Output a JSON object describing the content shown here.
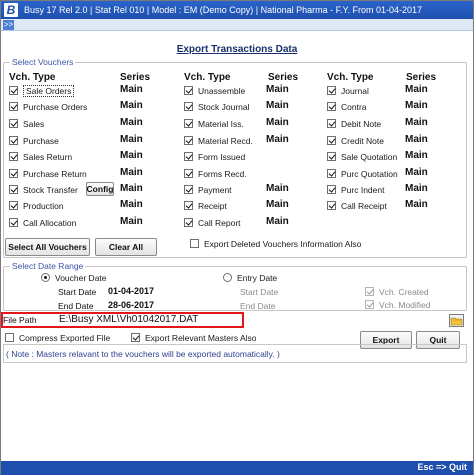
{
  "window": {
    "title": "Busy 17  Rel 2.0  |  Stat Rel 010  |  Model : EM (Demo Copy)  |  National Pharma - F.Y. From 01-04-2017",
    "logo_letter": "B",
    "expand_label": ">>"
  },
  "panel_title": "Export Transactions Data",
  "vouchers": {
    "legend": "Select Vouchers",
    "headers": {
      "vch_type": "Vch. Type",
      "series": "Series"
    },
    "columns": [
      [
        {
          "label": "Sale Orders",
          "series": "Main",
          "checked": true
        },
        {
          "label": "Purchase Orders",
          "series": "Main",
          "checked": true
        },
        {
          "label": "Sales",
          "series": "Main",
          "checked": true
        },
        {
          "label": "Purchase",
          "series": "Main",
          "checked": true
        },
        {
          "label": "Sales Return",
          "series": "Main",
          "checked": true
        },
        {
          "label": "Purchase Return",
          "series": "Main",
          "checked": true
        },
        {
          "label": "Stock Transfer",
          "series": "Main",
          "checked": true
        },
        {
          "label": "Production",
          "series": "Main",
          "checked": true
        },
        {
          "label": "Call Allocation",
          "series": "Main",
          "checked": true
        }
      ],
      [
        {
          "label": "Unassemble",
          "series": "Main",
          "checked": true
        },
        {
          "label": "Stock Journal",
          "series": "Main",
          "checked": true
        },
        {
          "label": "Material Iss.",
          "series": "Main",
          "checked": true
        },
        {
          "label": "Material Recd.",
          "series": "Main",
          "checked": true
        },
        {
          "label": "Form Issued",
          "series": "",
          "checked": true
        },
        {
          "label": "Forms Recd.",
          "series": "",
          "checked": true
        },
        {
          "label": "Payment",
          "series": "Main",
          "checked": true
        },
        {
          "label": "Receipt",
          "series": "Main",
          "checked": true
        },
        {
          "label": "Call Report",
          "series": "Main",
          "checked": true
        }
      ],
      [
        {
          "label": "Journal",
          "series": "Main",
          "checked": true
        },
        {
          "label": "Contra",
          "series": "Main",
          "checked": true
        },
        {
          "label": "Debit Note",
          "series": "Main",
          "checked": true
        },
        {
          "label": "Credit Note",
          "series": "Main",
          "checked": true
        },
        {
          "label": "Sale Quotation",
          "series": "Main",
          "checked": true
        },
        {
          "label": "Purc Quotation",
          "series": "Main",
          "checked": true
        },
        {
          "label": "Purc Indent",
          "series": "Main",
          "checked": true
        },
        {
          "label": "Call Receipt",
          "series": "Main",
          "checked": true
        }
      ]
    ],
    "config_label": "Config",
    "select_all_label": "Select All Vouchers",
    "clear_all_label": "Clear All",
    "export_deleted_label": "Export Deleted Vouchers Information Also"
  },
  "date_range": {
    "legend": "Select Date Range",
    "voucher_date_label": "Voucher Date",
    "entry_date_label": "Entry Date",
    "start_date_label": "Start Date",
    "end_date_label": "End Date",
    "voucher_start": "01-04-2017",
    "voucher_end": "28-06-2017",
    "vch_created_label": "Vch. Created",
    "vch_modified_label": "Vch. Modified"
  },
  "file_path": {
    "label": "File Path",
    "value": "E:\\Busy XML\\Vh01042017.DAT"
  },
  "options": {
    "compress_label": "Compress Exported File",
    "export_masters_label": "Export Relevant Masters Also"
  },
  "buttons": {
    "export": "Export",
    "quit": "Quit"
  },
  "note": "( Note :  Masters relavant to the vouchers will be exported automatically. )",
  "status": {
    "quit_hint": "Esc => Quit"
  },
  "colors": {
    "titlebar": "#1e4fae",
    "highlight": "#e3161c",
    "legend": "#3a55a8"
  }
}
